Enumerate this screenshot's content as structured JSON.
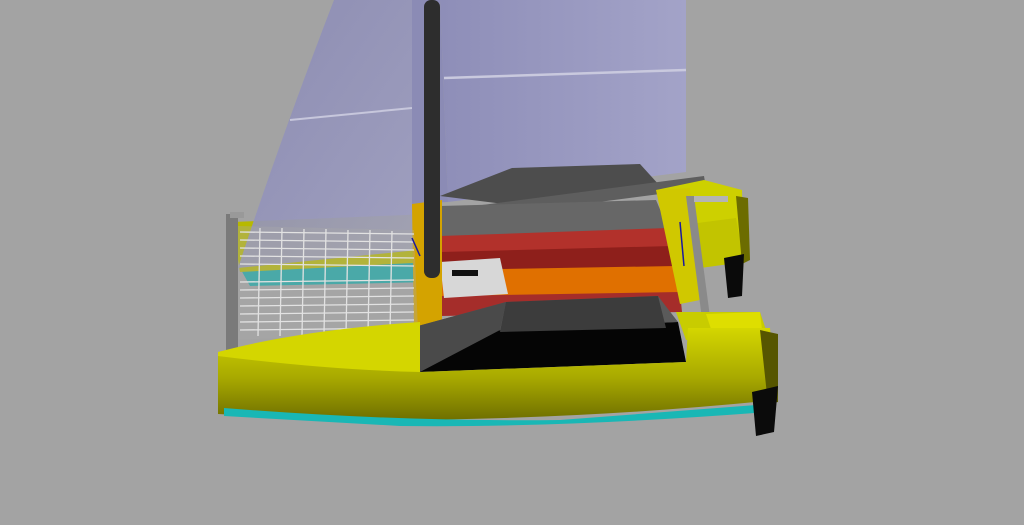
{
  "scene": {
    "subject": "catamaran-3d-render",
    "colors": {
      "background": "#a3a3a3",
      "sail": "#9d9dc4",
      "sail_shadow": "#8c8cb4",
      "hull_yellow": "#cfd200",
      "hull_yellow_dark": "#6e6e00",
      "hull_yellow_mid": "#a6a600",
      "waterline": "#19b7b5",
      "mast": "#2d2d2d",
      "deck_grey": "#5c5c5c",
      "deck_dark": "#3f3f3f",
      "cockpit_black": "#050505",
      "stripe_red": "#b2312b",
      "stripe_dark_red": "#8e1f1b",
      "stripe_orange": "#e07000",
      "trampoline": "#c8c8c8",
      "rail": "#7a7a7a"
    }
  }
}
